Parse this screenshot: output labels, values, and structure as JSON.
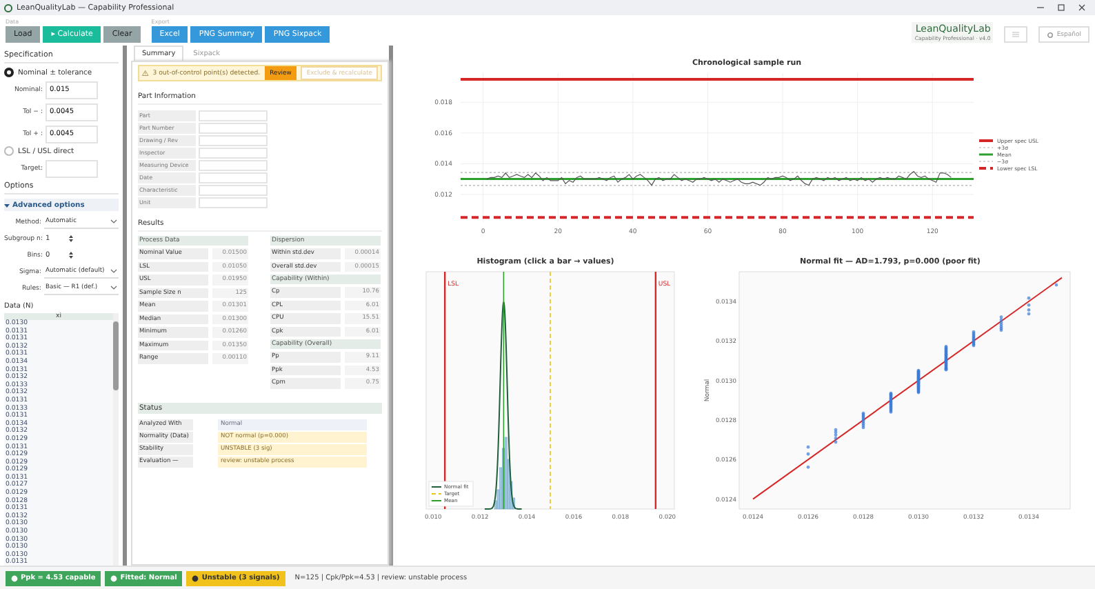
{
  "window": {
    "title": "LeanQualityLab — Capability Professional"
  },
  "toolbar": {
    "groups": [
      {
        "label": "Data",
        "buttons": [
          {
            "label": "Load",
            "kind": "neutral"
          },
          {
            "label": "▸ Calculate",
            "kind": "primary"
          },
          {
            "label": "Clear",
            "kind": "neutral"
          }
        ]
      },
      {
        "label": "Export",
        "buttons": [
          {
            "label": "Excel",
            "kind": "export"
          },
          {
            "label": "PNG Summary",
            "kind": "export"
          },
          {
            "label": "PNG Sixpack",
            "kind": "export"
          }
        ]
      }
    ]
  },
  "brand": {
    "name": "LeanQualityLab",
    "subtitle": "Capability Professional · v4.0",
    "language": "Español"
  },
  "specification": {
    "title": "Specification",
    "modes": [
      {
        "label": "Nominal ± tolerance",
        "selected": true,
        "fields": [
          {
            "label": "Nominal:",
            "value": "0.015"
          },
          {
            "label": "Tol − :",
            "value": "0.0045"
          },
          {
            "label": "Tol + :",
            "value": "0.0045"
          }
        ]
      },
      {
        "label": "LSL / USL direct",
        "selected": false,
        "fields": [
          {
            "label": "Target:"
          }
        ]
      }
    ]
  },
  "options": {
    "title": "Options",
    "advanced": {
      "label": "Advanced options",
      "expanded": true,
      "rows": [
        {
          "label": "Method:",
          "value": "Automatic",
          "kind": "select"
        },
        {
          "label": "Subgroup n:",
          "value": "1",
          "kind": "spin"
        },
        {
          "label": "Bins:",
          "value": "0",
          "kind": "spin"
        },
        {
          "label": "Sigma:",
          "value": "Automatic (default)",
          "kind": "select"
        },
        {
          "label": "Rules:",
          "value": "Basic — R1 (def.)",
          "kind": "select"
        }
      ]
    }
  },
  "data": {
    "title": "Data (N)",
    "column": "xi",
    "values": [
      "0.0130",
      "0.0131",
      "0.0131",
      "0.0132",
      "0.0131",
      "0.0134",
      "0.0131",
      "0.0132",
      "0.0133",
      "0.0132",
      "0.0131",
      "0.0133",
      "0.0131",
      "0.0134",
      "0.0132",
      "0.0129",
      "0.0131",
      "0.0129",
      "0.0129",
      "0.0129",
      "0.0131",
      "0.0127",
      "0.0129",
      "0.0128",
      "0.0131",
      "0.0132",
      "0.0130",
      "0.0130",
      "0.0130",
      "0.0130",
      "0.0130",
      "0.0131"
    ]
  },
  "tabs": [
    {
      "label": "Summary",
      "selected": true
    },
    {
      "label": "Sixpack",
      "selected": false
    }
  ],
  "alert": {
    "text": "3 out-of-control point(s) detected.",
    "actions": [
      {
        "label": "Review",
        "disabled": false
      },
      {
        "label": "Exclude & recalculate",
        "disabled": true
      }
    ]
  },
  "part_information": {
    "title": "Part Information",
    "fields": [
      "Part",
      "Part Number",
      "Drawing / Rev",
      "Inspector",
      "Measuring Device",
      "Date",
      "Characteristic",
      "Unit"
    ]
  },
  "results": {
    "title": "Results",
    "columns": [
      [
        {
          "title": "Process Data",
          "rows": [
            [
              "Nominal Value",
              "0.01500"
            ],
            [
              "LSL",
              "0.01050"
            ],
            [
              "USL",
              "0.01950"
            ],
            [
              "Sample Size n",
              "125"
            ],
            [
              "Mean",
              "0.01301"
            ],
            [
              "Median",
              "0.01300"
            ],
            [
              "Minimum",
              "0.01260"
            ],
            [
              "Maximum",
              "0.01350"
            ],
            [
              "Range",
              "0.00110"
            ]
          ]
        }
      ],
      [
        {
          "title": "Dispersion",
          "rows": [
            [
              "Within std.dev",
              "0.00014"
            ],
            [
              "Overall std.dev",
              "0.00015"
            ]
          ]
        },
        {
          "title": "Capability (Within)",
          "rows": [
            [
              "Cp",
              "10.76"
            ],
            [
              "CPL",
              "6.01"
            ],
            [
              "CPU",
              "15.51"
            ],
            [
              "Cpk",
              "6.01"
            ]
          ]
        },
        {
          "title": "Capability (Overall)",
          "rows": [
            [
              "Pp",
              "9.11"
            ],
            [
              "Ppk",
              "4.53"
            ],
            [
              "Cpm",
              "0.75"
            ]
          ]
        }
      ]
    ]
  },
  "status": {
    "title": "Status",
    "rows": [
      {
        "label": "Analyzed With",
        "value": "Normal",
        "kind": "info"
      },
      {
        "label": "Normality (Data)",
        "value": "NOT normal (p=0.000)",
        "kind": "warning"
      },
      {
        "label": "Stability",
        "value": "UNSTABLE (3 sig)",
        "kind": "warning"
      },
      {
        "label": "Evaluation —",
        "value": "review: unstable process",
        "kind": "warning"
      }
    ]
  },
  "run_chart": {
    "chart_data": {
      "type": "line",
      "title": "Chronological sample run",
      "xlim": [
        -6,
        131
      ],
      "ylim": [
        0.0102,
        0.0199
      ],
      "xticks": [
        0,
        20,
        40,
        60,
        80,
        100,
        120
      ],
      "yticks": [
        0.012,
        0.014,
        0.016,
        0.018
      ],
      "x": [
        1,
        2,
        3,
        4,
        5,
        6,
        7,
        8,
        9,
        10,
        11,
        12,
        13,
        14,
        15,
        16,
        17,
        18,
        19,
        20,
        21,
        22,
        23,
        24,
        25,
        26,
        27,
        28,
        29,
        30,
        31,
        32,
        33,
        34,
        35,
        36,
        37,
        38,
        39,
        40,
        41,
        42,
        43,
        44,
        45,
        46,
        47,
        48,
        49,
        50,
        51,
        52,
        53,
        54,
        55,
        56,
        57,
        58,
        59,
        60,
        61,
        62,
        63,
        64,
        65,
        66,
        67,
        68,
        69,
        70,
        71,
        72,
        73,
        74,
        75,
        76,
        77,
        78,
        79,
        80,
        81,
        82,
        83,
        84,
        85,
        86,
        87,
        88,
        89,
        90,
        91,
        92,
        93,
        94,
        95,
        96,
        97,
        98,
        99,
        100,
        101,
        102,
        103,
        104,
        105,
        106,
        107,
        108,
        109,
        110,
        111,
        112,
        113,
        114,
        115,
        116,
        117,
        118,
        119,
        120,
        121,
        122,
        123,
        124,
        125
      ],
      "series": [
        {
          "color": "#555555",
          "values": [
            0.013,
            0.0131,
            0.0131,
            0.0132,
            0.0131,
            0.0134,
            0.0131,
            0.0132,
            0.0133,
            0.0132,
            0.0131,
            0.0133,
            0.0131,
            0.0134,
            0.0132,
            0.0129,
            0.0131,
            0.0129,
            0.0129,
            0.0129,
            0.0131,
            0.0127,
            0.0129,
            0.0128,
            0.0131,
            0.0132,
            0.013,
            0.013,
            0.013,
            0.013,
            0.0131,
            0.013,
            0.0129,
            0.0131,
            0.0132,
            0.0128,
            0.013,
            0.0131,
            0.0133,
            0.013,
            0.0132,
            0.0133,
            0.0131,
            0.0129,
            0.0126,
            0.013,
            0.0131,
            0.0129,
            0.013,
            0.013,
            0.0133,
            0.0131,
            0.0129,
            0.013,
            0.0129,
            0.0128,
            0.013,
            0.013,
            0.0131,
            0.013,
            0.0129,
            0.013,
            0.0128,
            0.013,
            0.0129,
            0.0128,
            0.0129,
            0.013,
            0.0128,
            0.0127,
            0.0127,
            0.0128,
            0.0127,
            0.0126,
            0.0128,
            0.0131,
            0.013,
            0.0131,
            0.0131,
            0.0132,
            0.0131,
            0.0129,
            0.013,
            0.0132,
            0.0129,
            0.0127,
            0.0126,
            0.013,
            0.0131,
            0.013,
            0.0129,
            0.0131,
            0.013,
            0.0131,
            0.0129,
            0.013,
            0.0131,
            0.0129,
            0.013,
            0.0129,
            0.0131,
            0.0129,
            0.013,
            0.0128,
            0.013,
            0.0131,
            0.013,
            0.0131,
            0.013,
            0.013,
            0.0132,
            0.0131,
            0.013,
            0.0133,
            0.0135,
            0.0132,
            0.0131,
            0.0132,
            0.013,
            0.0129,
            0.0128,
            0.0134,
            0.0134,
            0.0133,
            0.0131
          ]
        }
      ],
      "grid": true,
      "legend": "right",
      "ref_lines": [
        {
          "axis": "y",
          "value": 0.0195,
          "label": "Upper spec USL",
          "color": "#d62728"
        },
        {
          "axis": "y",
          "value": 0.01343,
          "label": "+3σ",
          "color": "#b0b0b0"
        },
        {
          "axis": "y",
          "value": 0.01301,
          "label": "Mean",
          "color": "#2ca02c"
        },
        {
          "axis": "y",
          "value": 0.01259,
          "label": "−3σ",
          "color": "#b0b0b0"
        },
        {
          "axis": "y",
          "value": 0.0105,
          "label": "Lower spec LSL",
          "color": "#d62728"
        }
      ]
    }
  },
  "histogram": {
    "title": "Histogram  (click a bar → values)",
    "xticks": [
      "0.010",
      "0.012",
      "0.014",
      "0.016",
      "0.018",
      "0.020"
    ],
    "markers": [
      "LSL",
      "USL"
    ],
    "legend": [
      {
        "label": "Normal fit",
        "kind": "fit"
      },
      {
        "label": "Target",
        "kind": "target"
      },
      {
        "label": "Mean",
        "kind": "mean"
      }
    ]
  },
  "probability_plot": {
    "title": "Normal fit — AD=1.793, p=0.000 (poor fit)",
    "ylabel": "Normal",
    "xticks": [
      "0.0124",
      "0.0126",
      "0.0128",
      "0.0130",
      "0.0132",
      "0.0134"
    ],
    "yticks": [
      "0.0134",
      "0.0132",
      "0.0130",
      "0.0128",
      "0.0126",
      "0.0124"
    ]
  },
  "status_bar": {
    "badges": [
      {
        "label": "Ppk = 4.53 capable",
        "color": "#3ea55a",
        "kind": "ok"
      },
      {
        "label": "Fitted: Normal",
        "color": "#3ea55a",
        "kind": "ok"
      },
      {
        "label": "Unstable (3 signals)",
        "color": "#f1c21b",
        "kind": "warn"
      }
    ],
    "summary": "N=125 | Cpk/Ppk=4.53 | review: unstable process"
  }
}
